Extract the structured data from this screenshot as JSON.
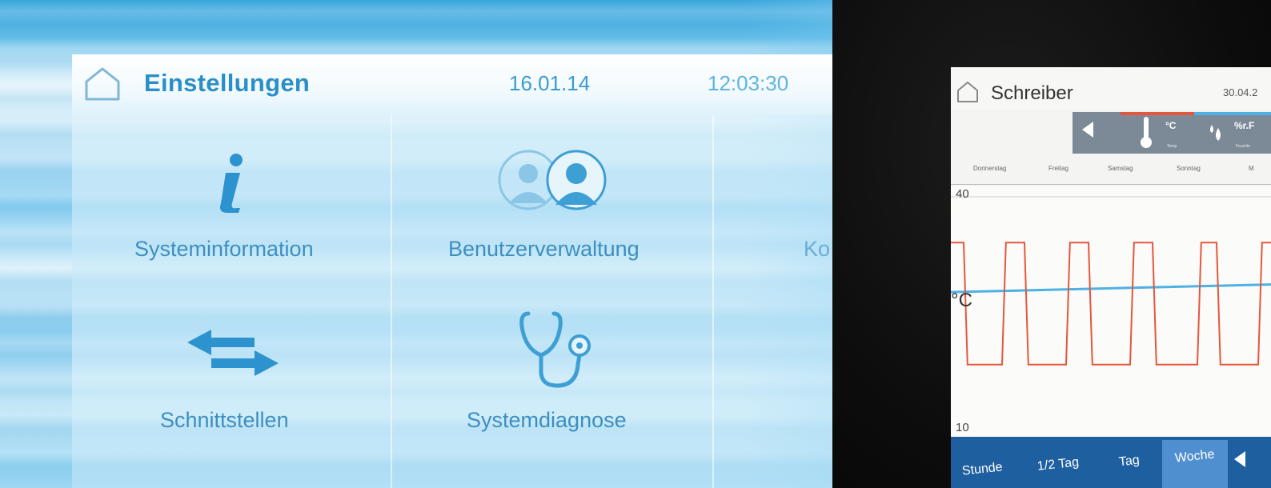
{
  "settings": {
    "title": "Einstellungen",
    "date": "16.01.14",
    "time": "12:03:30",
    "tiles": [
      {
        "label": "Systeminformation",
        "icon": "info-icon"
      },
      {
        "label": "Benutzerverwaltung",
        "icon": "users-icon"
      },
      {
        "label": "Ko",
        "icon": ""
      },
      {
        "label": "Schnittstellen",
        "icon": "interfaces-arrows-icon"
      },
      {
        "label": "Systemdiagnose",
        "icon": "stethoscope-icon"
      }
    ]
  },
  "recorder": {
    "title": "Schreiber",
    "date": "30.04.2",
    "toolbar": {
      "temp_unit": "°C",
      "temp_sub": "Temp",
      "humidity_unit": "%r.F",
      "humidity_sub": "Feuchte"
    },
    "days": [
      "Donnerstag",
      "Freitag",
      "Samstag",
      "Sonntag",
      "M"
    ],
    "y_max_label": "40",
    "y_min_label": "10",
    "y_unit": "°C",
    "footer_buttons": [
      "Stunde",
      "1/2 Tag",
      "Tag",
      "Woche"
    ],
    "active_button": "Woche"
  },
  "colors": {
    "accent_blue": "#2a8fc8",
    "temp_series": "#e4573d",
    "humidity_series": "#4eb1e4",
    "footer_blue": "#1e5fa0"
  },
  "chart_data": {
    "type": "line",
    "xlabel": "",
    "ylabel": "°C",
    "ylim": [
      10,
      40
    ],
    "x_categories": [
      "Donnerstag",
      "Freitag",
      "Samstag",
      "Sonntag",
      "M"
    ],
    "series": [
      {
        "color": "#e4573d",
        "pattern": "square-wave",
        "high": 34,
        "low": 18,
        "transitions_x": [
          0.04,
          0.16,
          0.23,
          0.36,
          0.43,
          0.56,
          0.63,
          0.77,
          0.83,
          0.96
        ]
      },
      {
        "color": "#4eb1e4",
        "start": 27.5,
        "end": 28.5
      }
    ]
  }
}
